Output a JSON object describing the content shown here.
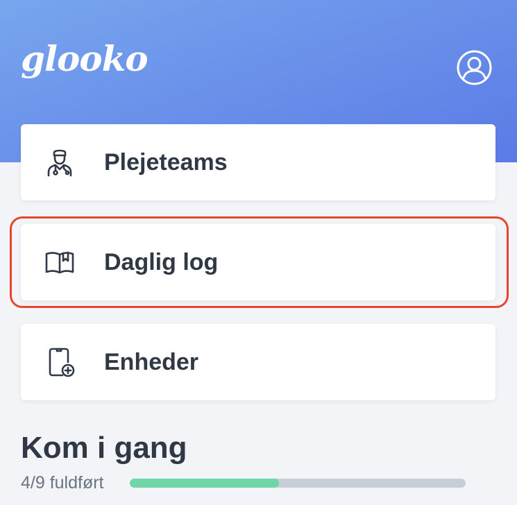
{
  "header": {
    "logo_text": "glooko",
    "profile_icon": "user-circle-icon"
  },
  "menu": {
    "items": [
      {
        "label": "Plejeteams",
        "icon": "care-team-icon"
      },
      {
        "label": "Daglig log",
        "icon": "book-icon",
        "highlighted": true
      },
      {
        "label": "Enheder",
        "icon": "device-add-icon"
      }
    ]
  },
  "getting_started": {
    "title": "Kom i gang",
    "progress_text": "4/9 fuldført",
    "progress_fraction": 0.444
  },
  "colors": {
    "header_gradient_start": "#77a6ee",
    "header_gradient_end": "#5a7be6",
    "highlight_border": "#e8452f",
    "progress_fill": "#6fd6a7",
    "progress_track": "#c8ced6"
  }
}
